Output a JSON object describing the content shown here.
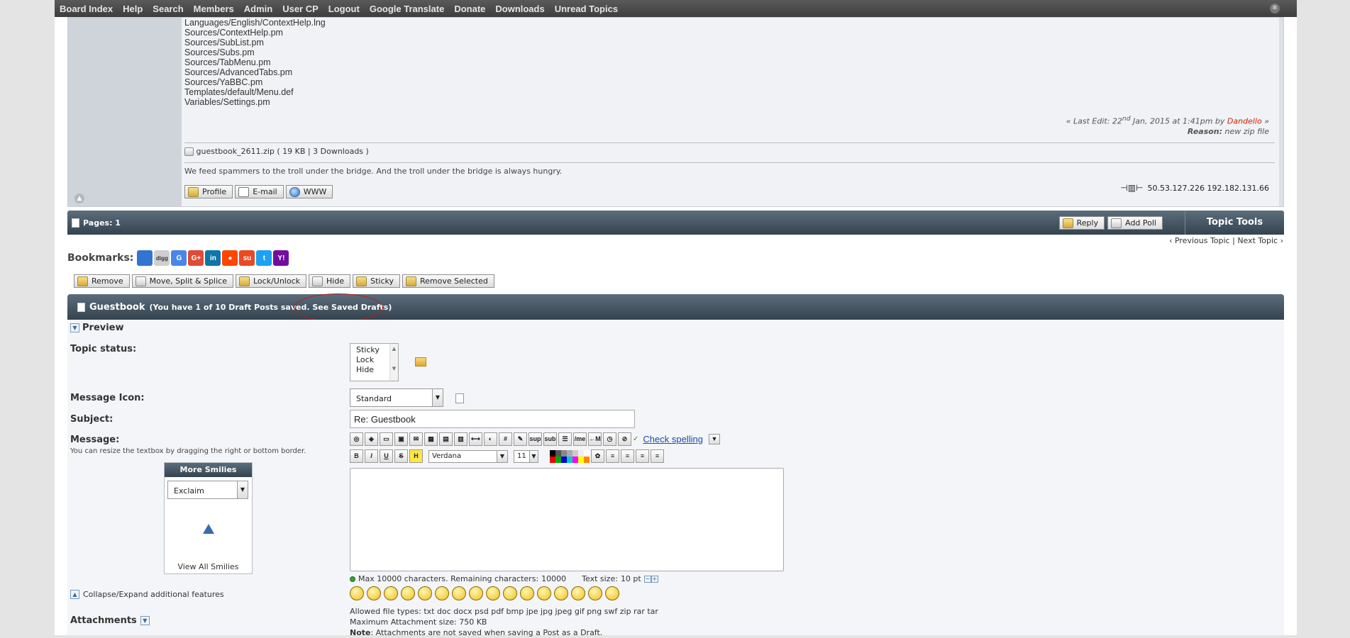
{
  "nav": {
    "items": [
      "Board Index",
      "Help",
      "Search",
      "Members",
      "Admin",
      "User CP",
      "Logout",
      "Google Translate",
      "Donate",
      "Downloads",
      "Unread Topics"
    ]
  },
  "post": {
    "files": [
      "Languages/English/ContextHelp.lng",
      "Sources/ContextHelp.pm",
      "Sources/SubList.pm",
      "Sources/Subs.pm",
      "Sources/TabMenu.pm",
      "Sources/AdvancedTabs.pm",
      "Sources/YaBBC.pm",
      "Templates/default/Menu.def",
      "Variables/Settings.pm"
    ],
    "last_edit_prefix": "« Last Edit: 22",
    "last_edit_sup": "nd",
    "last_edit_date": " Jan, 2015 at 1:41pm by ",
    "last_edit_editor": "Dandello",
    "last_edit_suffix": " »",
    "reason_label": "Reason:",
    "reason_value": " new zip file",
    "attachment_name": "guestbook_2611.zip",
    "attachment_meta": " ( 19 KB | 3 Downloads )",
    "signature": "We feed spammers to the troll under the bridge. And the troll under the bridge is always hungry.",
    "profile_label": "Profile",
    "email_label": "E-mail",
    "www_label": "WWW",
    "ip_text": "50.53.127.226 192.182.131.66"
  },
  "pagesbar": {
    "pages_label": "Pages: 1",
    "reply_label": "Reply",
    "add_poll_label": "Add Poll",
    "topic_tools_label": "Topic Tools",
    "previous_topic": "‹ Previous Topic",
    "separator": " | ",
    "next_topic": "Next Topic ›"
  },
  "bookmarks": {
    "label": "Bookmarks:",
    "sites": [
      {
        "name": "delicious",
        "glyph": "",
        "color": "#3274d1"
      },
      {
        "name": "digg",
        "glyph": "digg",
        "color": "#cfcfcf"
      },
      {
        "name": "google",
        "glyph": "G",
        "color": "#4a86e8"
      },
      {
        "name": "google-plus",
        "glyph": "G+",
        "color": "#dd4b39"
      },
      {
        "name": "linkedin",
        "glyph": "in",
        "color": "#0e76a8"
      },
      {
        "name": "reddit",
        "glyph": "●",
        "color": "#ff4500"
      },
      {
        "name": "stumbleupon",
        "glyph": "su",
        "color": "#eb4924"
      },
      {
        "name": "twitter",
        "glyph": "t",
        "color": "#1da1f2"
      },
      {
        "name": "yahoo",
        "glyph": "Y!",
        "color": "#720e9e"
      }
    ]
  },
  "moderation": {
    "remove": "Remove",
    "move": "Move, Split & Splice",
    "lock": "Lock/Unlock",
    "hide": "Hide",
    "sticky": "Sticky",
    "remove_selected": "Remove Selected"
  },
  "editor": {
    "title": "Guestbook",
    "draft_info_prefix": "(You have 1 of 10 Draft Posts saved. ",
    "draft_link": "See Saved Drafts",
    "draft_info_suffix": ")",
    "preview_label": "Preview",
    "topic_status_label": "Topic status:",
    "status_options": [
      "Sticky",
      "Lock",
      "Hide"
    ],
    "message_icon_label": "Message Icon:",
    "message_icon_value": "Standard",
    "subject_label": "Subject:",
    "subject_value": "Re: Guestbook",
    "message_label": "Message:",
    "resize_hint": "You can resize the textbox by dragging the right or bottom border.",
    "check_spelling": "Check spelling",
    "font_value": "Verdana",
    "size_value": "11",
    "more_smilies": "More Smilies",
    "smilies_set": "Exclaim",
    "view_all_smilies": "View All Smilies",
    "max_chars_text": "Max 10000 characters. Remaining characters: ",
    "remaining_chars": "10000",
    "text_size_label": "Text size: ",
    "text_size_value": "10 pt",
    "collapse_label": "Collapse/Expand additional features",
    "attachments_label": "Attachments",
    "allowed_types": "Allowed file types: txt doc docx psd pdf bmp jpe jpg jpeg gif png swf zip rar tar",
    "max_attach": "Maximum Attachment size: 750 KB",
    "note_label": "Note",
    "note_text": ": Attachments are not saved when saving a Post as a Draft."
  },
  "colors": {
    "accent_dark": "#34434f",
    "editor_link": "#cc2200",
    "highlight_circle": "#c41a1a"
  }
}
